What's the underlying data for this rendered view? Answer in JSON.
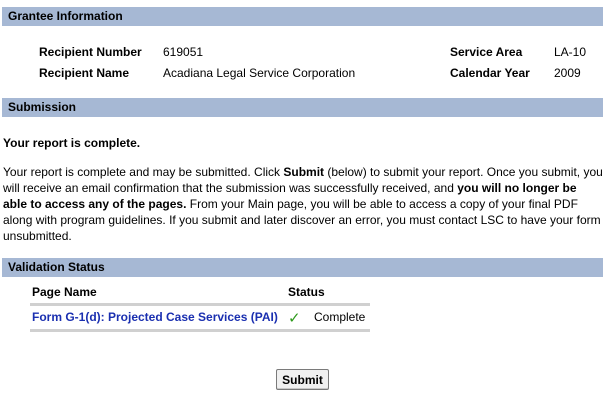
{
  "grantee": {
    "title": "Grantee Information",
    "recipient_number_label": "Recipient Number",
    "recipient_number": "619051",
    "recipient_name_label": "Recipient Name",
    "recipient_name": "Acadiana Legal Service Corporation",
    "service_area_label": "Service Area",
    "service_area": "LA-10",
    "calendar_year_label": "Calendar Year",
    "calendar_year": "2009"
  },
  "submission": {
    "title": "Submission",
    "heading": "Your report is complete.",
    "text_1": "Your report is complete and may be submitted. Click ",
    "text_submit": "Submit",
    "text_2": " (below) to submit your report. Once you submit, you will receive an email confirmation that the submission was successfully received, and ",
    "text_bold": "you will no longer be able to access any of the pages.",
    "text_3": " From your Main page, you will be able to access a copy of your final PDF along with program guidelines. If you submit and later discover an error, you must contact LSC to have your form unsubmitted."
  },
  "validation": {
    "title": "Validation Status",
    "col_page": "Page Name",
    "col_status": "Status",
    "rows": [
      {
        "page": "Form G-1(d): Projected Case Services (PAI)",
        "status": "Complete",
        "icon": "checkmark-icon"
      }
    ]
  },
  "submit_button": {
    "label": "Submit"
  },
  "colors": {
    "section_bar": "#a6b8d4",
    "link": "#1a2fb0",
    "check": "#2e9a1c"
  }
}
